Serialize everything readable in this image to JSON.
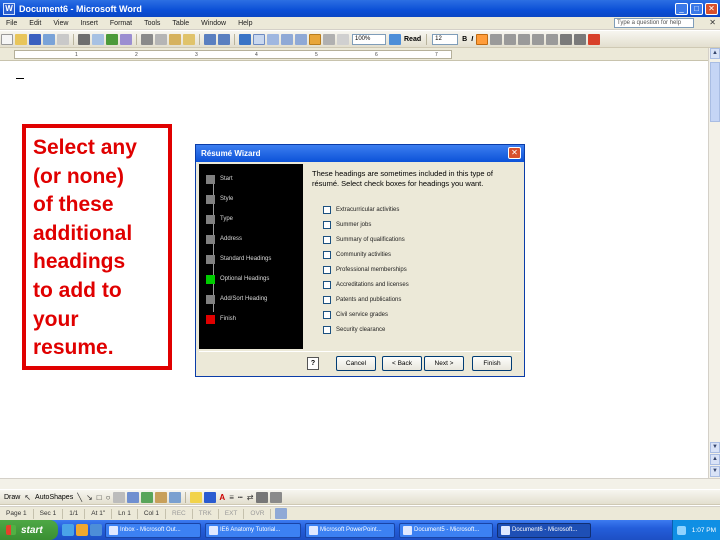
{
  "window": {
    "title": "Document6 - Microsoft Word"
  },
  "menubar": {
    "items": [
      "File",
      "Edit",
      "View",
      "Insert",
      "Format",
      "Tools",
      "Table",
      "Window",
      "Help"
    ],
    "help_placeholder": "Type a question for help"
  },
  "toolbar": {
    "zoom": "100%",
    "read_label": "Read",
    "font_size": "12"
  },
  "callout": {
    "lines": [
      "Select any",
      "(or none)",
      "of these",
      "additional",
      "headings",
      "to add to",
      "your",
      "resume."
    ]
  },
  "dialog": {
    "title": "Résumé Wizard",
    "steps": [
      "Start",
      "Style",
      "Type",
      "Address",
      "Standard Headings",
      "Optional Headings",
      "Add/Sort Heading",
      "Finish"
    ],
    "current_step": "Optional Headings",
    "instruction": "These headings are sometimes included in this type of résumé. Select check boxes for headings you want.",
    "options": [
      {
        "label": "Extracurricular activities",
        "checked": false
      },
      {
        "label": "Summer jobs",
        "checked": false
      },
      {
        "label": "Summary of qualifications",
        "checked": false
      },
      {
        "label": "Community activities",
        "checked": false
      },
      {
        "label": "Professional memberships",
        "checked": false
      },
      {
        "label": "Accreditations and licenses",
        "checked": false
      },
      {
        "label": "Patents and publications",
        "checked": false
      },
      {
        "label": "Civil service grades",
        "checked": false
      },
      {
        "label": "Security clearance",
        "checked": false
      }
    ],
    "buttons": {
      "cancel": "Cancel",
      "back": "< Back",
      "next": "Next >",
      "finish": "Finish",
      "help": "?"
    }
  },
  "statusbar": {
    "page": "Page 1",
    "sec": "Sec 1",
    "pos": "1/1",
    "at": "At 1\"",
    "ln": "Ln 1",
    "col": "Col 1",
    "rec": "REC",
    "trk": "TRK",
    "ext": "EXT",
    "ovr": "OVR"
  },
  "drawbar": {
    "draw_label": "Draw",
    "autoshapes_label": "AutoShapes"
  },
  "taskbar": {
    "start_label": "start",
    "tasks": [
      "Inbox - Microsoft Out...",
      "IE6 Anatomy Tutorial...",
      "Microsoft PowerPoint...",
      "Document5 - Microsoft...",
      "Document6 - Microsoft..."
    ],
    "clock": "1:07 PM"
  },
  "colors": {
    "callout_red": "#e00000",
    "current_step_green": "#00cc00",
    "title_blue": "#0b4fd6"
  }
}
